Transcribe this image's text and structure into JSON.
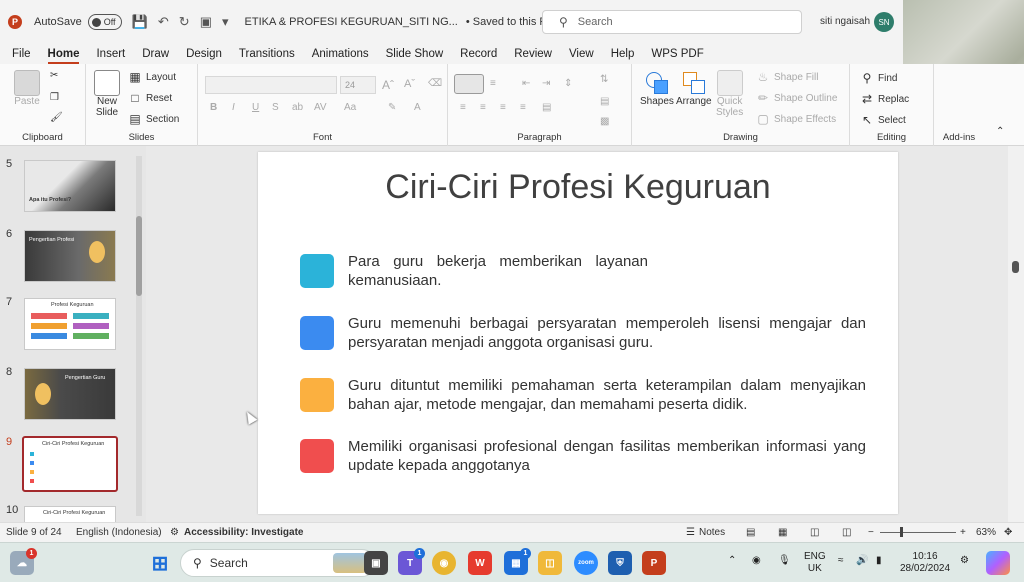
{
  "titlebar": {
    "autosave_label": "AutoSave",
    "autosave_state": "Off",
    "doc_title": "ETIKA & PROFESI KEGURUAN_SITI NG...",
    "saved_status": "• Saved to this PC",
    "search_placeholder": "Search",
    "user_name": "siti ngaisah",
    "user_initials": "SN"
  },
  "menu": {
    "tabs": [
      "File",
      "Home",
      "Insert",
      "Draw",
      "Design",
      "Transitions",
      "Animations",
      "Slide Show",
      "Record",
      "Review",
      "View",
      "Help",
      "WPS PDF"
    ],
    "active_tab": "Home"
  },
  "ribbon": {
    "clipboard": {
      "paste": "Paste",
      "label": "Clipboard"
    },
    "slides": {
      "new_slide": "New",
      "new_slide_2": "Slide",
      "layout": "Layout",
      "reset": "Reset",
      "section": "Section",
      "label": "Slides"
    },
    "font": {
      "size": "24",
      "label": "Font"
    },
    "paragraph": {
      "label": "Paragraph"
    },
    "drawing": {
      "shapes": "Shapes",
      "arrange": "Arrange",
      "quick_styles": "Quick",
      "quick_styles_2": "Styles",
      "shape_fill": "Shape Fill",
      "shape_outline": "Shape Outline",
      "shape_effects": "Shape Effects",
      "label": "Drawing"
    },
    "editing": {
      "find": "Find",
      "replace": "Replac",
      "select": "Select",
      "label": "Editing"
    },
    "addins": {
      "label": "Add-ins"
    }
  },
  "thumbnails": [
    {
      "num": "5",
      "title": "Apa itu Profesi?"
    },
    {
      "num": "6",
      "title": "Pengertian Profesi"
    },
    {
      "num": "7",
      "title": "Profesi Keguruan"
    },
    {
      "num": "8",
      "title": "Pengertian Guru"
    },
    {
      "num": "9",
      "title": "Ciri-Ciri Profesi Keguruan"
    },
    {
      "num": "10",
      "title": "Ciri-Ciri Profesi Keguruan"
    }
  ],
  "slide": {
    "title": "Ciri-Ciri Profesi Keguruan",
    "items": [
      {
        "text": "Para guru bekerja memberikan layanan kemanusiaan.",
        "color": "#2bb3d9"
      },
      {
        "text": "Guru memenuhi berbagai persyaratan memperoleh lisensi mengajar dan persyaratan menjadi anggota organisasi guru.",
        "color": "#3b8bf0"
      },
      {
        "text": "Guru dituntut memiliki pemahaman serta keterampilan dalam menyajikan bahan ajar, metode mengajar, dan memahami peserta didik.",
        "color": "#fbb040"
      },
      {
        "text": "Memiliki organisasi profesional dengan fasilitas memberikan informasi yang update kepada anggotanya",
        "color": "#f04e4e"
      }
    ]
  },
  "statusbar": {
    "slide_count": "Slide 9 of 24",
    "language": "English (Indonesia)",
    "accessibility": "Accessibility: Investigate",
    "notes": "Notes",
    "zoom": "63%"
  },
  "taskbar": {
    "search_label": "Search",
    "lang": "ENG",
    "region": "UK",
    "time": "10:16",
    "date": "28/02/2024",
    "weather_badge": "1",
    "teams_badge": "1",
    "store_badge": "1",
    "zoom_label": "zoom"
  }
}
